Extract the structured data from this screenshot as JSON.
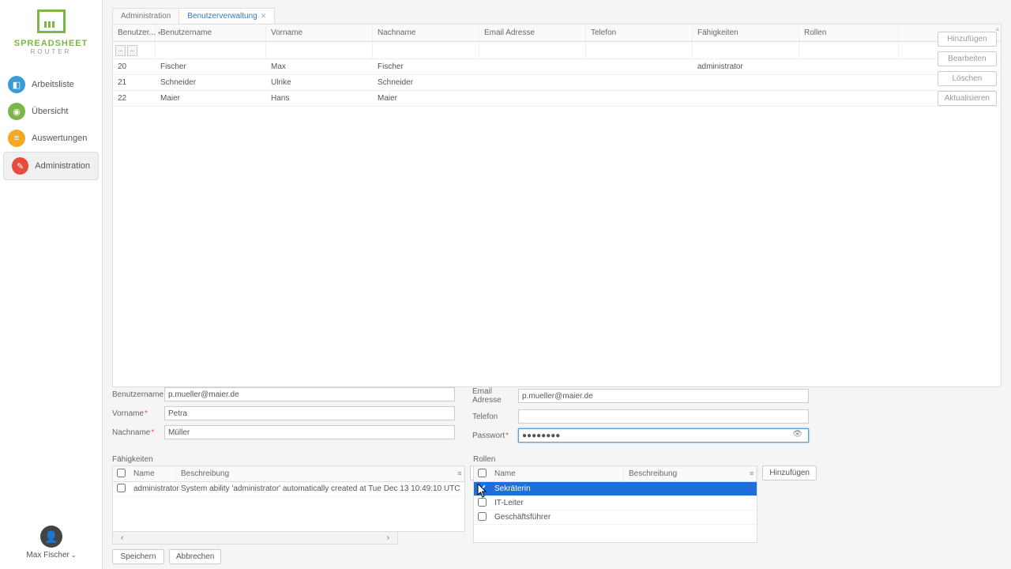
{
  "logo": {
    "line1": "SPREADSHEET",
    "line2": "ROUTER"
  },
  "nav": [
    {
      "label": "Arbeitsliste",
      "icon": "◧",
      "cls": "c-blue"
    },
    {
      "label": "Übersicht",
      "icon": "◉",
      "cls": "c-green"
    },
    {
      "label": "Auswertungen",
      "icon": "≡",
      "cls": "c-orange"
    },
    {
      "label": "Administration",
      "icon": "✎",
      "cls": "c-red",
      "active": true
    }
  ],
  "user": {
    "name": "Max Fischer"
  },
  "tabs": [
    {
      "label": "Administration"
    },
    {
      "label": "Benutzerverwaltung",
      "active": true,
      "closable": true
    }
  ],
  "grid": {
    "columns": [
      "Benutzer...",
      "Benutzername",
      "Vorname",
      "Nachname",
      "Email Adresse",
      "Telefon",
      "Fähigkeiten",
      "Rollen"
    ],
    "widths": [
      54,
      140,
      135,
      135,
      135,
      135,
      135,
      126
    ],
    "rows": [
      {
        "id": "20",
        "bn": "Fischer",
        "vn": "Max",
        "nn": "Fischer",
        "em": "",
        "tel": "",
        "fk": "administrator",
        "rl": ""
      },
      {
        "id": "21",
        "bn": "Schneider",
        "vn": "Ulrike",
        "nn": "Schneider",
        "em": "",
        "tel": "",
        "fk": "",
        "rl": ""
      },
      {
        "id": "22",
        "bn": "Maier",
        "vn": "Hans",
        "nn": "Maier",
        "em": "",
        "tel": "",
        "fk": "",
        "rl": ""
      }
    ]
  },
  "buttons": {
    "add": "Hinzufügen",
    "edit": "Bearbeiten",
    "delete": "Löschen",
    "refresh": "Aktualisieren",
    "save": "Speichern",
    "cancel": "Abbrechen"
  },
  "form": {
    "labels": {
      "bn": "Benutzername",
      "vn": "Vorname",
      "nn": "Nachname",
      "em": "Email Adresse",
      "tel": "Telefon",
      "pw": "Passwort"
    },
    "values": {
      "bn": "p.mueller@maier.de",
      "vn": "Petra",
      "nn": "Müller",
      "em": "p.mueller@maier.de",
      "tel": "",
      "pw": "●●●●●●●●"
    }
  },
  "faehigkeiten": {
    "title": "Fähigkeiten",
    "cols": {
      "name": "Name",
      "desc": "Beschreibung"
    },
    "rows": [
      {
        "name": "administrator",
        "desc": "System ability 'administrator' automatically created at Tue Dec 13 10:49:10 UTC"
      }
    ]
  },
  "rollen": {
    "title": "Rollen",
    "cols": {
      "name": "Name",
      "desc": "Beschreibung"
    },
    "rows": [
      {
        "name": "Sekräterin",
        "checked": true,
        "selected": true
      },
      {
        "name": "IT-Leiter",
        "checked": false
      },
      {
        "name": "Geschäftsführer",
        "checked": false
      }
    ]
  }
}
